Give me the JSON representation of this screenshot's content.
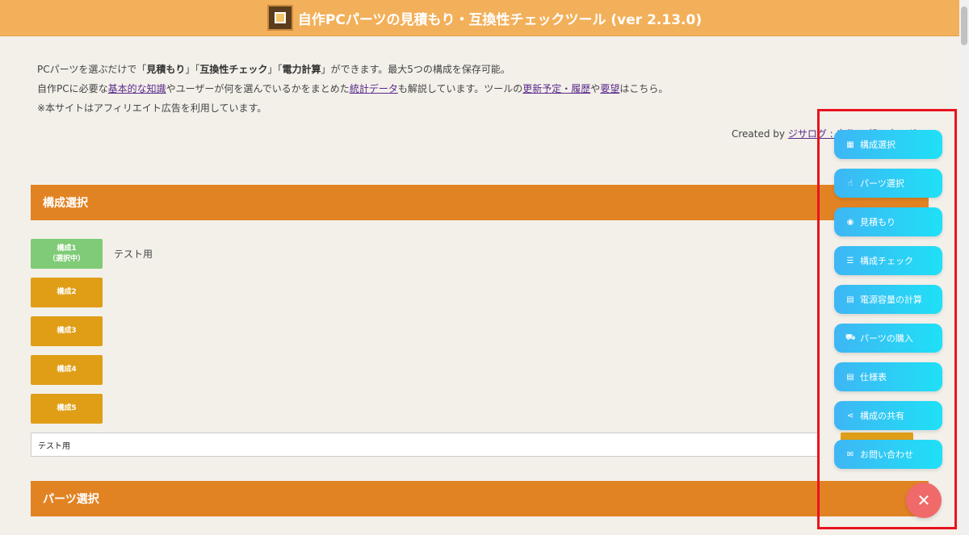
{
  "header": {
    "title": "自作PCパーツの見積もり・互換性チェックツール (ver 2.13.0)",
    "logo_icon": "cpu-chip-icon"
  },
  "intro": {
    "line1_pre": "PCパーツを選ぶだけで「",
    "line1_b1": "見積もり",
    "line1_mid1": "」「",
    "line1_b2": "互換性チェック",
    "line1_mid2": "」「",
    "line1_b3": "電力計算",
    "line1_post": "」ができます。最大5つの構成を保存可能。",
    "line2_pre": "自作PCに必要な",
    "line2_link1": "基本的な知識",
    "line2_mid1": "やユーザーが何を選んでいるかをまとめた",
    "line2_link2": "統計データ",
    "line2_mid2": "も解説しています。ツールの",
    "line2_link3": "更新予定・履歴",
    "line2_mid3": "や",
    "line2_link4": "要望",
    "line2_post": "はこちら。",
    "line3": "※本サイトはアフィリエイト広告を利用しています。"
  },
  "credit": {
    "prefix": "Created by ",
    "link": "ジサログ : 自作PC組み立てガイド"
  },
  "sections": {
    "config_title": "構成選択",
    "parts_title": "パーツ選択"
  },
  "configs": [
    {
      "label_line1": "構成1",
      "label_line2": "（選択中）",
      "active": true
    },
    {
      "label_line1": "構成2",
      "label_line2": "",
      "active": false
    },
    {
      "label_line1": "構成3",
      "label_line2": "",
      "active": false
    },
    {
      "label_line1": "構成4",
      "label_line2": "",
      "active": false
    },
    {
      "label_line1": "構成5",
      "label_line2": "",
      "active": false
    }
  ],
  "config_name": "テスト用",
  "name_input_value": "テスト用",
  "menu": [
    {
      "label": "構成選択",
      "icon": "sitemap-icon"
    },
    {
      "label": "パーツ選択",
      "icon": "pointer-hand-icon"
    },
    {
      "label": "見積もり",
      "icon": "coins-icon"
    },
    {
      "label": "構成チェック",
      "icon": "checklist-icon"
    },
    {
      "label": "電源容量の計算",
      "icon": "calculator-icon"
    },
    {
      "label": "パーツの購入",
      "icon": "cart-icon"
    },
    {
      "label": "仕様表",
      "icon": "table-icon"
    },
    {
      "label": "構成の共有",
      "icon": "share-icon"
    },
    {
      "label": "お問い合わせ",
      "icon": "envelope-icon"
    }
  ],
  "close_icon": "close-icon",
  "colors": {
    "header": "#f2b05a",
    "section": "#e28323",
    "config_button": "#e09e17",
    "config_active": "#7fcb77",
    "menu_gradient_start": "#3eb6f4",
    "menu_gradient_end": "#1fe0f6",
    "close_button": "#f06a6a",
    "highlight_border": "#e8141e"
  }
}
